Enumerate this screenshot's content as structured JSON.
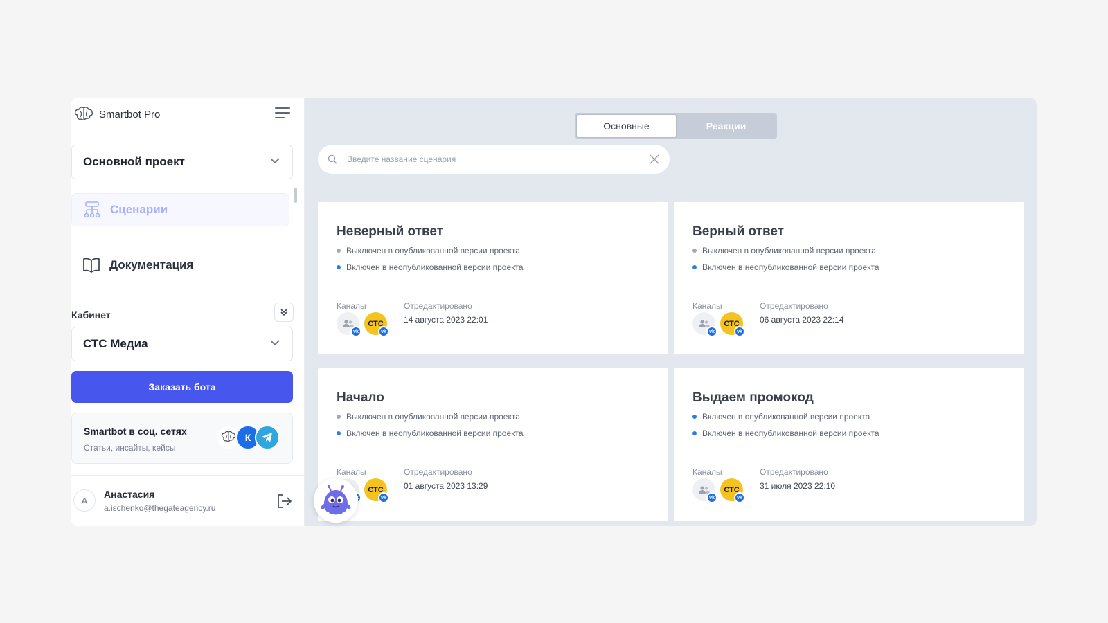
{
  "brand": {
    "name": "Smartbot Pro",
    "logo_icon": "brain-icon"
  },
  "sidebar": {
    "project_select": {
      "value": "Основной проект"
    },
    "nav": [
      {
        "label": "Сценарии",
        "icon": "flowchart-icon",
        "active": true
      },
      {
        "label": "Документация",
        "icon": "book-icon",
        "active": false
      }
    ],
    "cabinet_label": "Кабинет",
    "cabinet_select": {
      "value": "СТС Медиа"
    },
    "order_button": "Заказать бота",
    "social": {
      "title": "Smartbot в соц. сетях",
      "subtitle": "Статьи, инсайты, кейсы",
      "vk_text": "К"
    },
    "user": {
      "initial": "А",
      "name": "Анастасия",
      "email": "a.ischenko@thegateagency.ru"
    }
  },
  "main": {
    "tabs": [
      {
        "label": "Основные",
        "active": true
      },
      {
        "label": "Реакции",
        "active": false
      }
    ],
    "search": {
      "placeholder": "Введите название сценария"
    },
    "channels_label": "Каналы",
    "edited_label": "Отредактировано",
    "ctc_text": "СТС",
    "vk_badge_text": "vk",
    "cards": [
      {
        "title": "Неверный ответ",
        "status_published": {
          "text": "Выключен в опубликованной версии проекта",
          "color": "#a3a8b3"
        },
        "status_unpublished": {
          "text": "Включен в неопубликованной версии проекта",
          "color": "#2a7fe0"
        },
        "edited": "14 августа 2023 22:01"
      },
      {
        "title": "Верный ответ",
        "status_published": {
          "text": "Выключен в опубликованной версии проекта",
          "color": "#a3a8b3"
        },
        "status_unpublished": {
          "text": "Включен в неопубликованной версии проекта",
          "color": "#2a7fe0"
        },
        "edited": "06 августа 2023 22:14"
      },
      {
        "title": "Начало",
        "status_published": {
          "text": "Выключен в опубликованной версии проекта",
          "color": "#a3a8b3"
        },
        "status_unpublished": {
          "text": "Включен в неопубликованной версии проекта",
          "color": "#2a7fe0"
        },
        "edited": "01 августа 2023 13:29"
      },
      {
        "title": "Выдаем промокод",
        "status_published": {
          "text": "Включен в опубликованной версии проекта",
          "color": "#2a7fe0"
        },
        "status_unpublished": {
          "text": "Включен в неопубликованной версии проекта",
          "color": "#2a7fe0"
        },
        "edited": "31 июля 2023 22:10"
      }
    ]
  },
  "colors": {
    "accent": "#4757ee",
    "active_nav": "#aab0f5",
    "ctc_yellow": "#f5c31d",
    "vk_blue": "#1a6fe8"
  }
}
